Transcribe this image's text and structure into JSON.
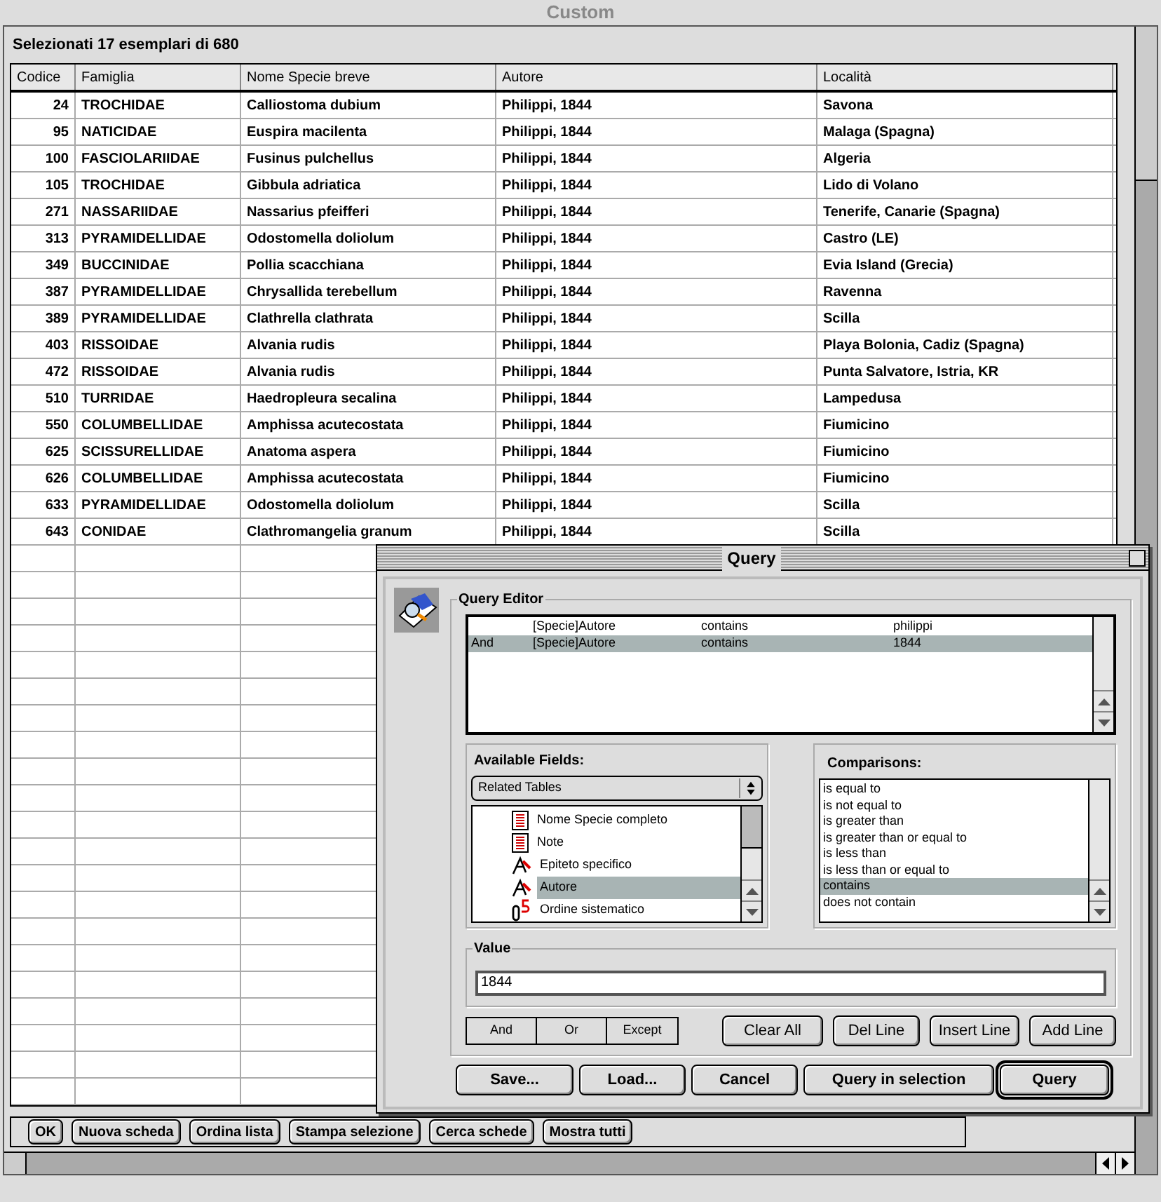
{
  "window": {
    "title": "Custom"
  },
  "selection_info": "Selezionati 17 esemplari di 680",
  "table": {
    "columns": [
      "Codice",
      "Famiglia",
      "Nome Specie breve",
      "Autore",
      "Località"
    ],
    "rows": [
      [
        "24",
        "TROCHIDAE",
        "Calliostoma dubium",
        "Philippi, 1844",
        "Savona"
      ],
      [
        "95",
        "NATICIDAE",
        "Euspira macilenta",
        "Philippi, 1844",
        "Malaga (Spagna)"
      ],
      [
        "100",
        "FASCIOLARIIDAE",
        "Fusinus pulchellus",
        "Philippi, 1844",
        "Algeria"
      ],
      [
        "105",
        "TROCHIDAE",
        "Gibbula adriatica",
        "Philippi, 1844",
        "Lido di Volano"
      ],
      [
        "271",
        "NASSARIIDAE",
        "Nassarius pfeifferi",
        "Philippi, 1844",
        "Tenerife, Canarie (Spagna)"
      ],
      [
        "313",
        "PYRAMIDELLIDAE",
        "Odostomella doliolum",
        "Philippi, 1844",
        "Castro (LE)"
      ],
      [
        "349",
        "BUCCINIDAE",
        "Pollia scacchiana",
        "Philippi, 1844",
        "Evia Island (Grecia)"
      ],
      [
        "387",
        "PYRAMIDELLIDAE",
        "Chrysallida terebellum",
        "Philippi, 1844",
        "Ravenna"
      ],
      [
        "389",
        "PYRAMIDELLIDAE",
        "Clathrella clathrata",
        "Philippi, 1844",
        "Scilla"
      ],
      [
        "403",
        "RISSOIDAE",
        "Alvania rudis",
        "Philippi, 1844",
        "Playa Bolonia, Cadiz (Spagna)"
      ],
      [
        "472",
        "RISSOIDAE",
        "Alvania rudis",
        "Philippi, 1844",
        "Punta Salvatore, Istria, KR"
      ],
      [
        "510",
        "TURRIDAE",
        "Haedropleura secalina",
        "Philippi, 1844",
        "Lampedusa"
      ],
      [
        "550",
        "COLUMBELLIDAE",
        "Amphissa acutecostata",
        "Philippi, 1844",
        "Fiumicino"
      ],
      [
        "625",
        "SCISSURELLIDAE",
        "Anatoma aspera",
        "Philippi, 1844",
        "Fiumicino"
      ],
      [
        "626",
        "COLUMBELLIDAE",
        "Amphissa acutecostata",
        "Philippi, 1844",
        "Fiumicino"
      ],
      [
        "633",
        "PYRAMIDELLIDAE",
        "Odostomella doliolum",
        "Philippi, 1844",
        "Scilla"
      ],
      [
        "643",
        "CONIDAE",
        "Clathromangelia granum",
        "Philippi, 1844",
        "Scilla"
      ]
    ]
  },
  "buttons": [
    "OK",
    "Nuova scheda",
    "Ordina lista",
    "Stampa selezione",
    "Cerca schede",
    "Mostra tutti"
  ],
  "query": {
    "title": "Query",
    "editor_label": "Query Editor",
    "lines": [
      {
        "field": "[Specie]Autore",
        "comparison": "contains",
        "value": "philippi",
        "selected": false
      },
      {
        "conjunction": "And",
        "field": "[Specie]Autore",
        "comparison": "contains",
        "value": "1844",
        "selected": true
      }
    ],
    "fields_label": "Available Fields:",
    "fields_popup": "Related Tables",
    "fields": [
      {
        "name": "Nome Specie completo",
        "kind": "text",
        "selected": false
      },
      {
        "name": "Note",
        "kind": "text",
        "selected": false
      },
      {
        "name": "Epiteto specifico",
        "kind": "alpha",
        "selected": false
      },
      {
        "name": "Autore",
        "kind": "alpha",
        "selected": true
      },
      {
        "name": "Ordine sistematico",
        "kind": "number",
        "selected": false
      }
    ],
    "comparisons_label": "Comparisons:",
    "comparisons": [
      {
        "label": "is equal to",
        "selected": false
      },
      {
        "label": "is not equal to",
        "selected": false
      },
      {
        "label": "is greater than",
        "selected": false
      },
      {
        "label": "is greater than or equal to",
        "selected": false
      },
      {
        "label": "is less than",
        "selected": false
      },
      {
        "label": "is less than or equal to",
        "selected": false
      },
      {
        "label": "contains",
        "selected": true
      },
      {
        "label": "does not contain",
        "selected": false
      }
    ],
    "value_label": "Value",
    "value": "1844",
    "conjunctions": [
      "And",
      "Or",
      "Except"
    ],
    "line_buttons": [
      "Clear All",
      "Del Line",
      "Insert Line",
      "Add Line"
    ],
    "actions": [
      {
        "label": "Save...",
        "default": false
      },
      {
        "label": "Load...",
        "default": false
      },
      {
        "label": "Cancel",
        "default": false
      },
      {
        "label": "Query in selection",
        "default": false
      },
      {
        "label": "Query",
        "default": true
      }
    ]
  }
}
